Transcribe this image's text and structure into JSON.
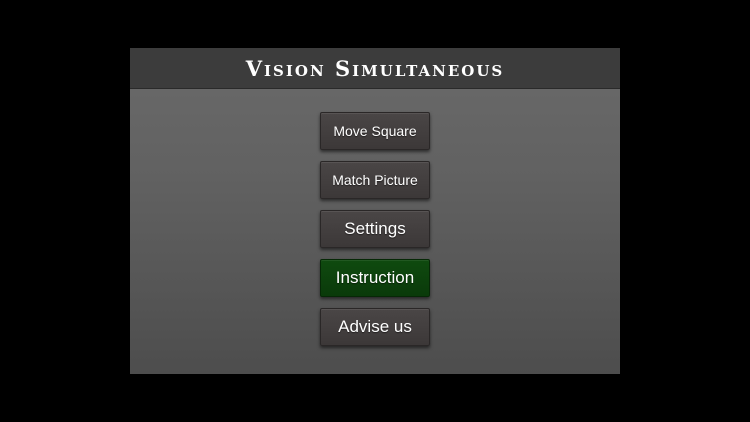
{
  "app": {
    "title": "Vision Simultaneous"
  },
  "menu": {
    "buttons": [
      {
        "label": "Move Square"
      },
      {
        "label": "Match Picture"
      },
      {
        "label": "Settings"
      },
      {
        "label": "Instruction",
        "selected": true
      },
      {
        "label": "Advise us"
      }
    ]
  },
  "colors": {
    "background": "#000000",
    "title_bar": "#3c3c3c",
    "button": "#433f3f",
    "button_selected": "#0d420d",
    "text": "#ffffff"
  }
}
